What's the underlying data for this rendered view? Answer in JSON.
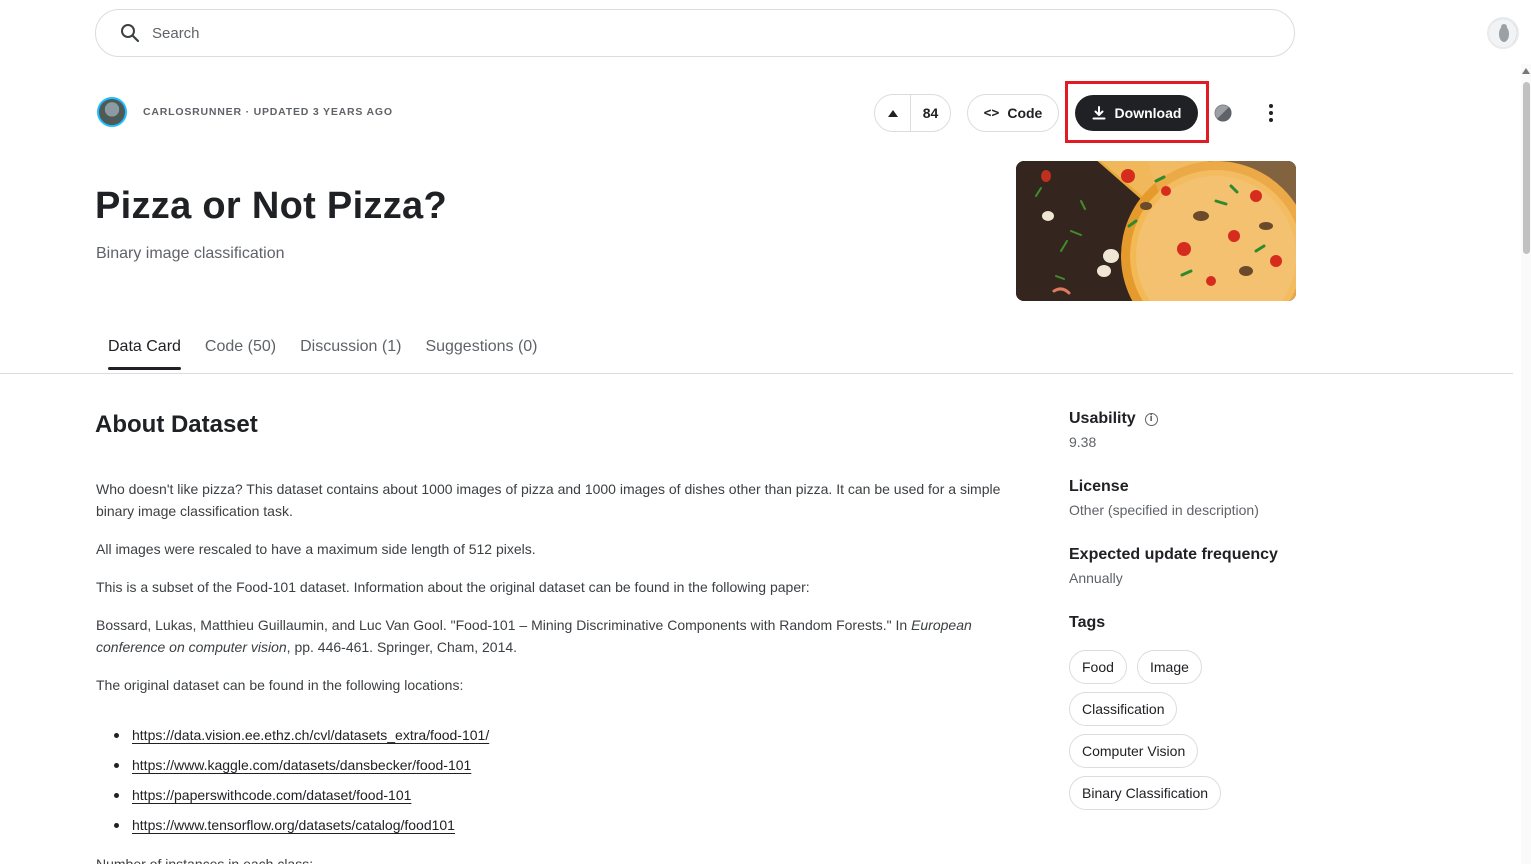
{
  "search": {
    "placeholder": "Search"
  },
  "owner": {
    "name": "CARLOSRUNNER",
    "updated": "UPDATED 3 YEARS AGO",
    "separator": "·"
  },
  "actions": {
    "vote_count": "84",
    "code_label": "Code",
    "download_label": "Download"
  },
  "dataset": {
    "title": "Pizza or Not Pizza?",
    "subtitle": "Binary image classification"
  },
  "tabs": [
    {
      "label": "Data Card",
      "active": true
    },
    {
      "label": "Code (50)",
      "active": false
    },
    {
      "label": "Discussion (1)",
      "active": false
    },
    {
      "label": "Suggestions (0)",
      "active": false
    }
  ],
  "about": {
    "heading": "About Dataset",
    "p1": "Who doesn't like pizza? This dataset contains about 1000 images of pizza and 1000 images of dishes other than pizza. It can be used for a simple binary image classification task.",
    "p2": "All images were rescaled to have a maximum side length of 512 pixels.",
    "p3": "This is a subset of the Food-101 dataset. Information about the original dataset can be found in the following paper:",
    "p4_a": "Bossard, Lukas, Matthieu Guillaumin, and Luc Van Gool. \"Food-101 – Mining Discriminative Components with Random Forests.\" In ",
    "p4_em": "European conference on computer vision",
    "p4_b": ", pp. 446-461. Springer, Cham, 2014.",
    "p5": "The original dataset can be found in the following locations:",
    "links": [
      "https://data.vision.ee.ethz.ch/cvl/datasets_extra/food-101/",
      "https://www.kaggle.com/datasets/dansbecker/food-101",
      "https://paperswithcode.com/dataset/food-101",
      "https://www.tensorflow.org/datasets/catalog/food101"
    ],
    "cut": "Number of instances in each class:"
  },
  "sidebar": {
    "usability_label": "Usability",
    "usability_value": "9.38",
    "license_label": "License",
    "license_value": "Other (specified in description)",
    "frequency_label": "Expected update frequency",
    "frequency_value": "Annually",
    "tags_label": "Tags",
    "tags": [
      "Food",
      "Image",
      "Classification",
      "Computer Vision",
      "Binary Classification"
    ]
  },
  "colors": {
    "highlight": "#e01b24",
    "primary_button": "#202124",
    "avatar_ring": "#20beff"
  }
}
